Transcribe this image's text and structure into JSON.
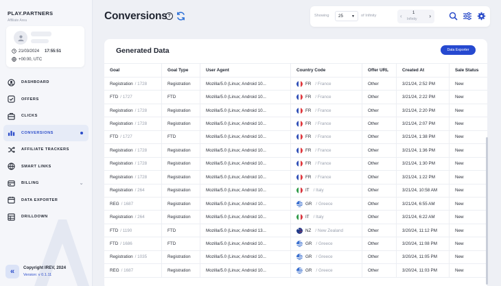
{
  "brand": {
    "name": "PLAY.PARTNERS",
    "subtitle": "Affiliate Area"
  },
  "user": {
    "date": "21/03/2024",
    "time": "17:55:51",
    "timezone": "+00:00, UTC"
  },
  "nav": [
    {
      "label": "DASHBOARD",
      "icon": "dashboard-icon",
      "active": false
    },
    {
      "label": "OFFERS",
      "icon": "offers-icon",
      "active": false
    },
    {
      "label": "CLICKS",
      "icon": "clicks-icon",
      "active": false
    },
    {
      "label": "CONVERSIONS",
      "icon": "conversions-icon",
      "active": true
    },
    {
      "label": "AFFILIATE TRACKERS",
      "icon": "shuffle-icon",
      "active": false
    },
    {
      "label": "SMART LINKS",
      "icon": "globe-icon",
      "active": false
    },
    {
      "label": "BILLING",
      "icon": "billing-icon",
      "active": false
    },
    {
      "label": "DATA EXPORTER",
      "icon": "export-icon",
      "active": false
    },
    {
      "label": "DRILLDOWN",
      "icon": "drilldown-icon",
      "active": false
    }
  ],
  "footer": {
    "copyright": "Copyright IREV, 2024",
    "version": "Version: v 0.1.11"
  },
  "header": {
    "title": "Conversions"
  },
  "toolbar": {
    "showing_label": "Showing",
    "per_page": "25",
    "of_label": "of Infinity",
    "page_current": "1",
    "page_total": "Infinity"
  },
  "card": {
    "title": "Generated Data",
    "export_label": "Data Exporter"
  },
  "table": {
    "columns": [
      "Goal",
      "Goal Type",
      "User Agent",
      "Country Code",
      "Offer URL",
      "Created At",
      "Sale Status"
    ],
    "rows": [
      {
        "goal": "Registration",
        "goal_id": "/ 1728",
        "type": "Registration",
        "ua": "Mozilla/5.0 (Linux; Android 10...",
        "cc": "FR",
        "country": "/ France",
        "flag": "fr",
        "offer": "Other",
        "created": "3/21/24, 2:52 PM",
        "status": "New"
      },
      {
        "goal": "FTD",
        "goal_id": "/ 1727",
        "type": "FTD",
        "ua": "Mozilla/5.0 (Linux; Android 10...",
        "cc": "FR",
        "country": "/ France",
        "flag": "fr",
        "offer": "Other",
        "created": "3/21/24, 2:22 PM",
        "status": "New"
      },
      {
        "goal": "Registration",
        "goal_id": "/ 1728",
        "type": "Registration",
        "ua": "Mozilla/5.0 (Linux; Android 10...",
        "cc": "FR",
        "country": "/ France",
        "flag": "fr",
        "offer": "Other",
        "created": "3/21/24, 2:20 PM",
        "status": "New"
      },
      {
        "goal": "Registration",
        "goal_id": "/ 1728",
        "type": "Registration",
        "ua": "Mozilla/5.0 (Linux; Android 10...",
        "cc": "FR",
        "country": "/ France",
        "flag": "fr",
        "offer": "Other",
        "created": "3/21/24, 2:07 PM",
        "status": "New"
      },
      {
        "goal": "FTD",
        "goal_id": "/ 1727",
        "type": "FTD",
        "ua": "Mozilla/5.0 (Linux; Android 10...",
        "cc": "FR",
        "country": "/ France",
        "flag": "fr",
        "offer": "Other",
        "created": "3/21/24, 1:38 PM",
        "status": "New"
      },
      {
        "goal": "Registration",
        "goal_id": "/ 1728",
        "type": "Registration",
        "ua": "Mozilla/5.0 (Linux; Android 10...",
        "cc": "FR",
        "country": "/ France",
        "flag": "fr",
        "offer": "Other",
        "created": "3/21/24, 1:36 PM",
        "status": "New"
      },
      {
        "goal": "Registration",
        "goal_id": "/ 1728",
        "type": "Registration",
        "ua": "Mozilla/5.0 (Linux; Android 10...",
        "cc": "FR",
        "country": "/ France",
        "flag": "fr",
        "offer": "Other",
        "created": "3/21/24, 1:30 PM",
        "status": "New"
      },
      {
        "goal": "Registration",
        "goal_id": "/ 1728",
        "type": "Registration",
        "ua": "Mozilla/5.0 (Linux; Android 10...",
        "cc": "FR",
        "country": "/ France",
        "flag": "fr",
        "offer": "Other",
        "created": "3/21/24, 1:22 PM",
        "status": "New"
      },
      {
        "goal": "Registration",
        "goal_id": "/ 264",
        "type": "Registration",
        "ua": "Mozilla/5.0 (Linux; Android 10...",
        "cc": "IT",
        "country": "/ Italy",
        "flag": "it",
        "offer": "Other",
        "created": "3/21/24, 10:58 AM",
        "status": "New"
      },
      {
        "goal": "REG",
        "goal_id": "/ 1687",
        "type": "Registration",
        "ua": "Mozilla/5.0 (Linux; Android 10...",
        "cc": "GR",
        "country": "/ Greece",
        "flag": "gr",
        "offer": "Other",
        "created": "3/21/24, 6:55 AM",
        "status": "New"
      },
      {
        "goal": "Registration",
        "goal_id": "/ 264",
        "type": "Registration",
        "ua": "Mozilla/5.0 (Linux; Android 10...",
        "cc": "IT",
        "country": "/ Italy",
        "flag": "it",
        "offer": "Other",
        "created": "3/21/24, 6:22 AM",
        "status": "New"
      },
      {
        "goal": "FTD",
        "goal_id": "/ 1190",
        "type": "FTD",
        "ua": "Mozilla/5.0 (Linux; Android 13...",
        "cc": "NZ",
        "country": "/ New Zealand",
        "flag": "nz",
        "offer": "Other",
        "created": "3/20/24, 11:12 PM",
        "status": "New"
      },
      {
        "goal": "FTD",
        "goal_id": "/ 1686",
        "type": "FTD",
        "ua": "Mozilla/5.0 (Linux; Android 10...",
        "cc": "GR",
        "country": "/ Greece",
        "flag": "gr",
        "offer": "Other",
        "created": "3/20/24, 11:08 PM",
        "status": "New"
      },
      {
        "goal": "Registration",
        "goal_id": "/ 1035",
        "type": "Registration",
        "ua": "Mozilla/5.0 (Linux; Android 10...",
        "cc": "GR",
        "country": "/ Greece",
        "flag": "gr",
        "offer": "Other",
        "created": "3/20/24, 11:05 PM",
        "status": "New"
      },
      {
        "goal": "REG",
        "goal_id": "/ 1687",
        "type": "Registration",
        "ua": "Mozilla/5.0 (Linux; Android 10...",
        "cc": "GR",
        "country": "/ Greece",
        "flag": "gr",
        "offer": "Other",
        "created": "3/20/24, 11:03 PM",
        "status": "New"
      }
    ]
  },
  "colors": {
    "accent": "#2649d0",
    "active_bg": "#e6ebf7",
    "page_bg": "#eef0f5"
  }
}
